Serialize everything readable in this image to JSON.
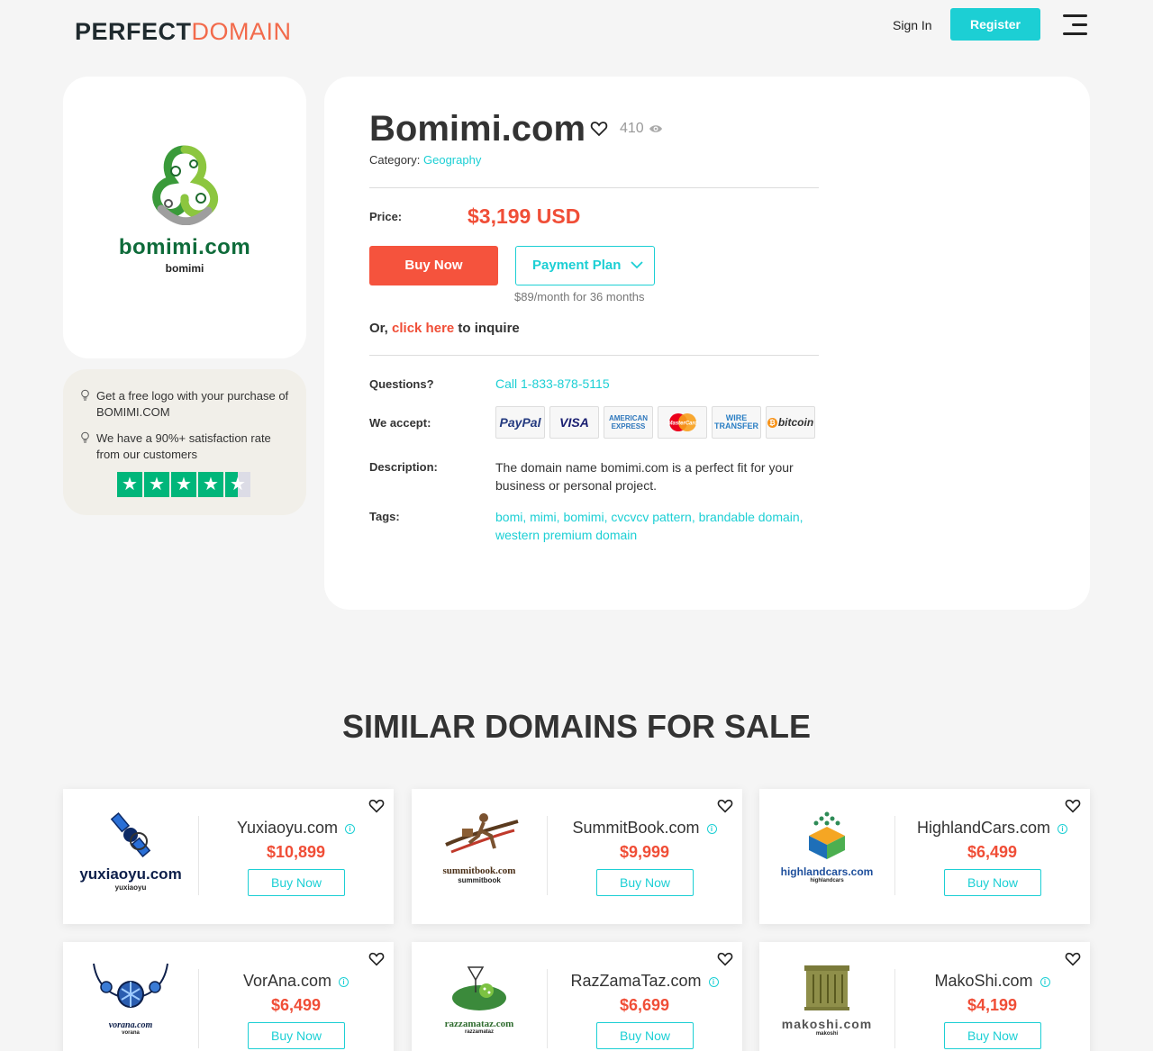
{
  "header": {
    "brand_part1": "PERFECT",
    "brand_part2": "DOMAIN",
    "signin_label": "Sign In",
    "register_label": "Register",
    "menu_icon": "hamburger-menu-icon"
  },
  "logo_card": {
    "domain_word": "bomimi.com",
    "domain_sub": "bomimi"
  },
  "perks": {
    "items": [
      "Get a free logo with your purchase of BOMIMI.COM",
      "We have a 90%+ satisfaction rate from our customers"
    ],
    "rating_stars": 4.5
  },
  "listing": {
    "title": "Bomimi.com",
    "views": "410",
    "category_label": "Category:",
    "category_value": "Geography",
    "price_label": "Price:",
    "price_value": "$3,199 USD",
    "buy_label": "Buy Now",
    "plan_label": "Payment Plan",
    "plan_note": "$89/month for 36 months",
    "inquire_prefix": "Or,",
    "inquire_link": "click here",
    "inquire_suffix": "to inquire",
    "questions_label": "Questions?",
    "phone": "Call 1-833-878-5115",
    "accept_label": "We accept:",
    "payments": [
      "PayPal",
      "VISA",
      "AMERICAN EXPRESS",
      "MasterCard",
      "WIRE TRANSFER",
      "bitcoin"
    ],
    "description_label": "Description:",
    "description": "The domain name bomimi.com is a perfect fit for your business or personal project.",
    "tags_label": "Tags:",
    "tags": "bomi, mimi, bomimi, cvcvcv pattern, brandable domain, western premium domain"
  },
  "similar": {
    "title": "SIMILAR DOMAINS FOR SALE",
    "buy_label": "Buy Now",
    "items": [
      {
        "name": "Yuxiaoyu.com",
        "price": "$10,899",
        "logo_word": "yuxiaoyu.com",
        "logo_sub": "yuxiaoyu"
      },
      {
        "name": "SummitBook.com",
        "price": "$9,999",
        "logo_word": "summitbook.com",
        "logo_sub": "summitbook"
      },
      {
        "name": "HighlandCars.com",
        "price": "$6,499",
        "logo_word": "highlandcars.com",
        "logo_sub": "highlandcars"
      },
      {
        "name": "VorAna.com",
        "price": "$6,499",
        "logo_word": "vorana.com",
        "logo_sub": "vorana"
      },
      {
        "name": "RazZamaTaz.com",
        "price": "$6,699",
        "logo_word": "razzamataz.com",
        "logo_sub": "razzamataz"
      },
      {
        "name": "MakoShi.com",
        "price": "$4,199",
        "logo_word": "makoshi.com",
        "logo_sub": "makoshi"
      }
    ]
  }
}
